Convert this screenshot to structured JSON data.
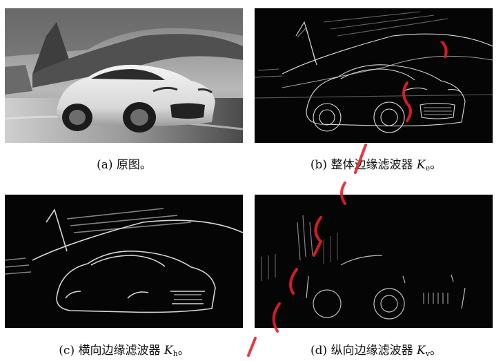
{
  "figure": {
    "panels": [
      {
        "label": "(a)",
        "caption_text": "原图。",
        "math_symbol": "",
        "math_subscript": "",
        "caption_end": "",
        "image_variant": "original"
      },
      {
        "label": "(b)",
        "caption_text": "整体边缘滤波器",
        "math_symbol": "K",
        "math_subscript": "e",
        "caption_end": "。",
        "image_variant": "edge-overall"
      },
      {
        "label": "(c)",
        "caption_text": "横向边缘滤波器",
        "math_symbol": "K",
        "math_subscript": "h",
        "caption_end": "。",
        "image_variant": "edge-horizontal"
      },
      {
        "label": "(d)",
        "caption_text": "纵向边缘滤波器",
        "math_symbol": "K",
        "math_subscript": "v",
        "caption_end": "。",
        "image_variant": "edge-vertical"
      }
    ]
  },
  "colors": {
    "watermark": "#e8202a",
    "edge_lines": "#f2f2f2",
    "edge_background": "#050505"
  }
}
